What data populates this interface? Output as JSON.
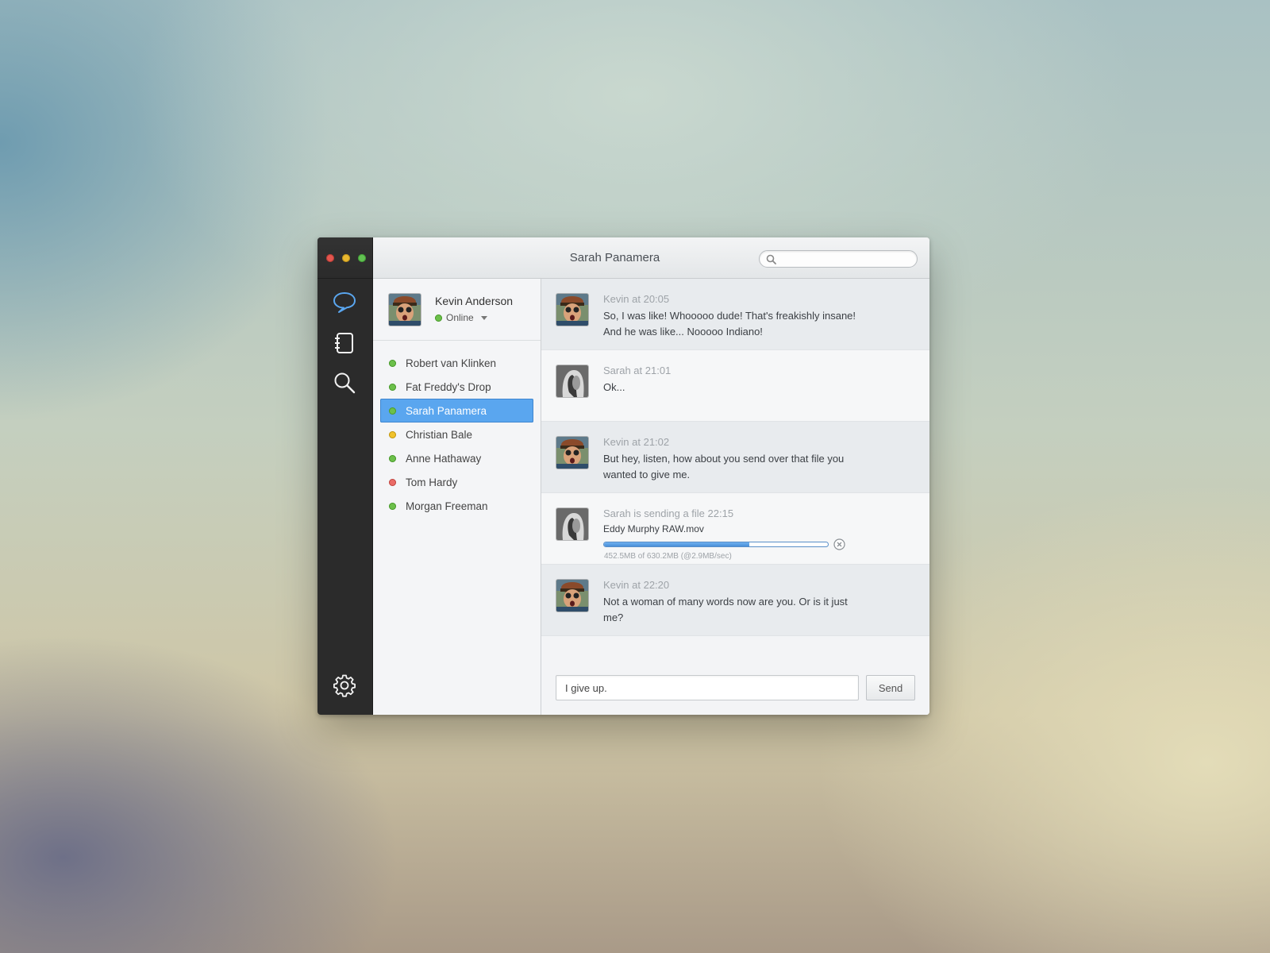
{
  "window": {
    "title": "Sarah Panamera"
  },
  "search": {
    "placeholder": "",
    "value": ""
  },
  "rail": {
    "icons": [
      "chat-bubble-icon",
      "address-book-icon",
      "search-icon",
      "gear-icon"
    ],
    "accent": "#5aa6ef"
  },
  "me": {
    "name": "Kevin Anderson",
    "status": "Online",
    "status_color": "#6cc04a"
  },
  "contacts": [
    {
      "name": "Robert van Klinken",
      "status": "online"
    },
    {
      "name": "Fat Freddy's Drop",
      "status": "online"
    },
    {
      "name": "Sarah Panamera",
      "status": "online",
      "selected": true
    },
    {
      "name": "Christian Bale",
      "status": "away"
    },
    {
      "name": "Anne Hathaway",
      "status": "online"
    },
    {
      "name": "Tom Hardy",
      "status": "busy"
    },
    {
      "name": "Morgan Freeman",
      "status": "online"
    }
  ],
  "messages": [
    {
      "from": "Kevin",
      "meta": "Kevin at 20:05",
      "text": "So, I was like! Whooooo dude! That's freakishly insane! And he was like... Nooooo Indiano!"
    },
    {
      "from": "Sarah",
      "meta": "Sarah at 21:01",
      "text": "Ok..."
    },
    {
      "from": "Kevin",
      "meta": "Kevin at 21:02",
      "text": "But hey, listen, how about you send over that file you wanted to give me."
    },
    {
      "from": "Sarah",
      "meta": "Sarah is sending a file 22:15",
      "file": {
        "name": "Eddy Murphy RAW.mov",
        "progress": 0.65,
        "detail": "452.5MB of 630.2MB (@2.9MB/sec)"
      }
    },
    {
      "from": "Kevin",
      "meta": "Kevin at 22:20",
      "text": "Not a woman of many words now are you. Or is it just me?"
    }
  ],
  "composer": {
    "value": "I give up.",
    "send_label": "Send"
  }
}
